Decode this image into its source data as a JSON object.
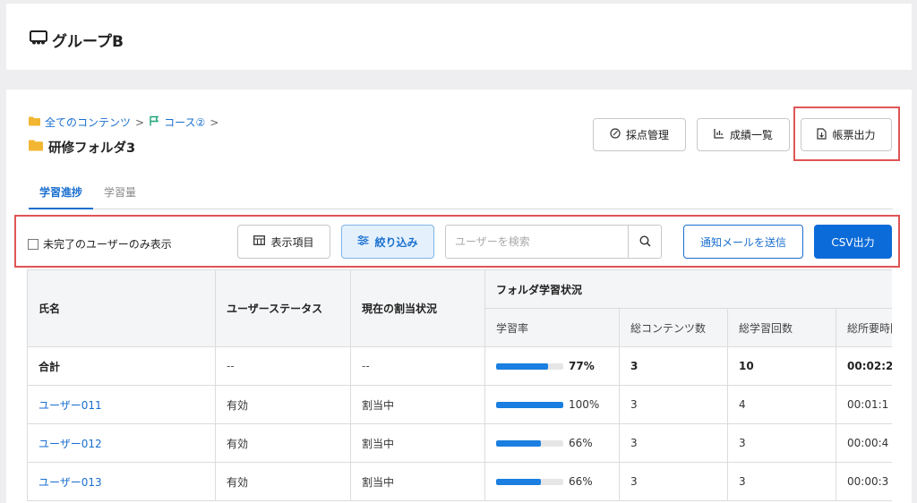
{
  "header": {
    "title": "グループB"
  },
  "breadcrumb": [
    {
      "label": "全てのコンテンツ",
      "icon": "folder-icon"
    },
    {
      "label": "コース②",
      "icon": "flag-icon"
    }
  ],
  "breadcrumb_sep": ">",
  "folder": {
    "title": "研修フォルダ3",
    "icon": "folder-icon"
  },
  "actions": {
    "grading": "採点管理",
    "grades": "成績一覧",
    "report": "帳票出力"
  },
  "tabs": [
    {
      "label": "学習進捗",
      "active": true
    },
    {
      "label": "学習量",
      "active": false
    }
  ],
  "toolbar": {
    "incomplete_only": "未完了のユーザーのみ表示",
    "display_items": "表示項目",
    "filter": "絞り込み",
    "search_placeholder": "ユーザーを検索",
    "notify": "通知メールを送信",
    "csv": "CSV出力"
  },
  "table": {
    "headers": {
      "name": "氏名",
      "status": "ユーザーステータス",
      "assignment": "現在の割当状況",
      "group": "フォルダ学習状況",
      "rate": "学習率",
      "contents": "総コンテンツ数",
      "count": "総学習回数",
      "time": "総所要時間"
    },
    "rows": [
      {
        "name": "合計",
        "status": "--",
        "assignment": "--",
        "rate": 0.77,
        "rate_label": "77%",
        "contents": "3",
        "count": "10",
        "time": "00:02:2"
      },
      {
        "name": "ユーザー011",
        "status": "有効",
        "assignment": "割当中",
        "rate": 1.0,
        "rate_label": "100%",
        "contents": "3",
        "count": "4",
        "time": "00:01:1"
      },
      {
        "name": "ユーザー012",
        "status": "有効",
        "assignment": "割当中",
        "rate": 0.66,
        "rate_label": "66%",
        "contents": "3",
        "count": "3",
        "time": "00:00:4"
      },
      {
        "name": "ユーザー013",
        "status": "有効",
        "assignment": "割当中",
        "rate": 0.66,
        "rate_label": "66%",
        "contents": "3",
        "count": "3",
        "time": "00:00:3"
      }
    ]
  },
  "colors": {
    "accent": "#1a6fcf",
    "primary_button": "#0b6bd8",
    "highlight_border": "#e05555",
    "folder": "#f2b632",
    "progress": "#1a7fe0"
  }
}
